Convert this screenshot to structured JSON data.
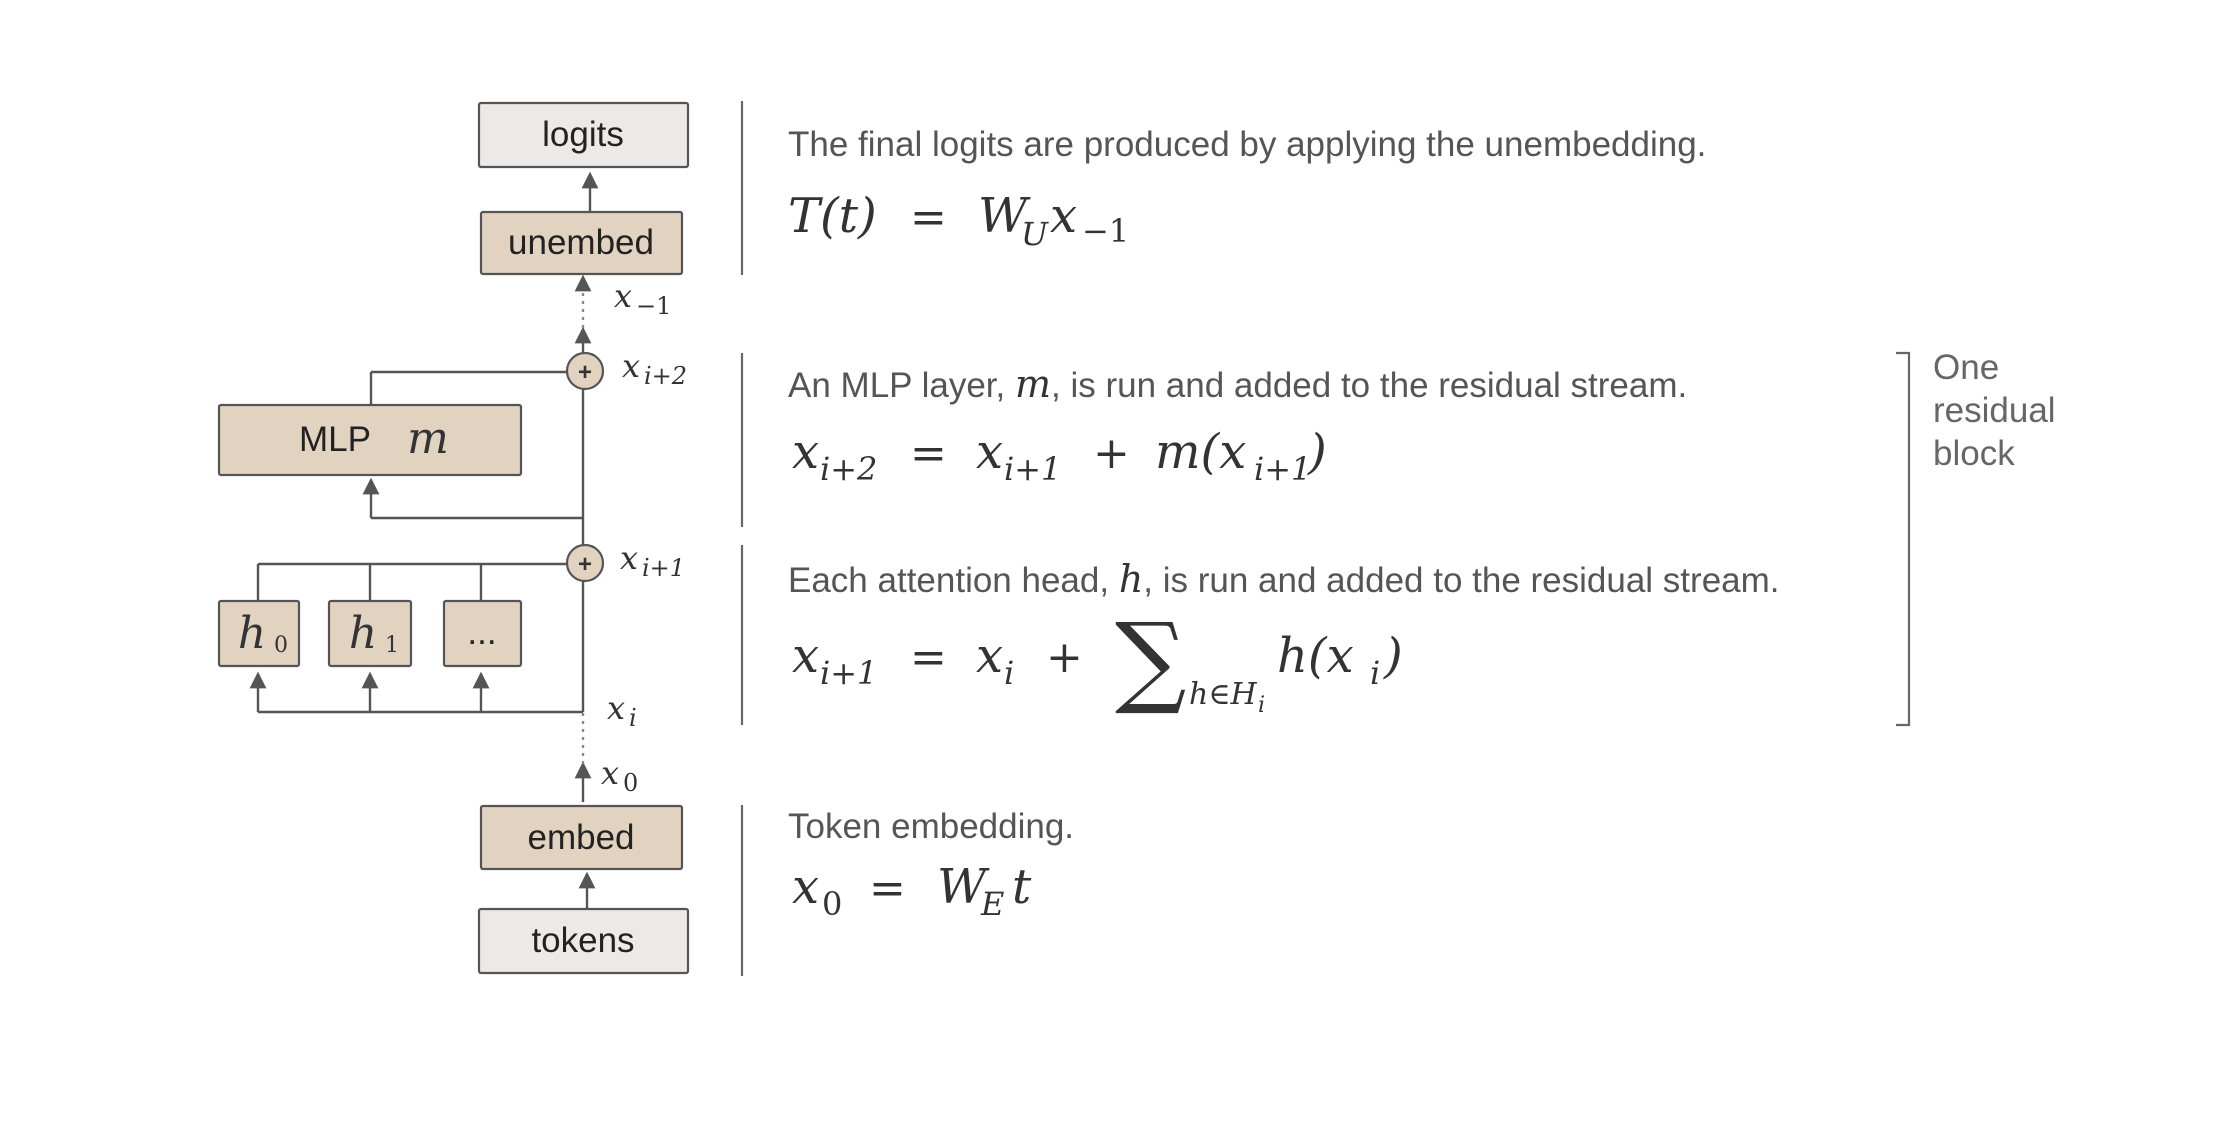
{
  "colors": {
    "io_fill": "#ece9e6",
    "component_fill": "#e2d3c1",
    "stroke": "#555555",
    "text": "#222222",
    "description_text": "#555555"
  },
  "nodes": {
    "logits": "logits",
    "unembed": "unembed",
    "mlp": "MLP",
    "mlp_symbol": "m",
    "head_0": "h",
    "head_0_sub": "0",
    "head_1": "h",
    "head_1_sub": "1",
    "head_more": "...",
    "embed": "embed",
    "tokens": "tokens",
    "add_symbol": "+"
  },
  "stream_labels": {
    "x_last": {
      "base": "x",
      "sub": "−1"
    },
    "x_i_plus_2": {
      "base": "x",
      "sub": "i+2"
    },
    "x_i_plus_1": {
      "base": "x",
      "sub": "i+1"
    },
    "x_i": {
      "base": "x",
      "sub": "i"
    },
    "x_0": {
      "base": "x",
      "sub": "0"
    }
  },
  "sections": {
    "unembed": {
      "text": "The final logits are produced by applying the unembedding.",
      "eq": {
        "lhs": "T(t)",
        "eq": "=",
        "w": "W",
        "w_sub": "U",
        "x": "x",
        "x_sub": "−1"
      }
    },
    "mlp": {
      "text_before": "An MLP layer, ",
      "text_symbol": "m",
      "text_after": ", is run and added to the residual stream.",
      "eq": {
        "l": "x",
        "l_sub": "i+2",
        "eq": "=",
        "a": "x",
        "a_sub": "i+1",
        "plus": "+",
        "m": "m(x",
        "m_sub": "i+1",
        "m_close": ")"
      }
    },
    "attention": {
      "text_before": "Each attention head, ",
      "text_symbol": "h",
      "text_after": ", is run and added to the residual stream.",
      "eq": {
        "l": "x",
        "l_sub": "i+1",
        "eq": "=",
        "a": "x",
        "a_sub": "i",
        "plus": "+",
        "sum": "∑",
        "sum_sub": "h∈H",
        "sum_sub_sub": "i",
        "h": "h(x",
        "h_sub": "i",
        "h_close": ")"
      }
    },
    "embed": {
      "text": "Token embedding.",
      "eq": {
        "l": "x",
        "l_sub": "0",
        "eq": "=",
        "w": "W",
        "w_sub": "E",
        "t": "t"
      }
    }
  },
  "residual_block": {
    "line1": "One",
    "line2": "residual",
    "line3": "block"
  }
}
